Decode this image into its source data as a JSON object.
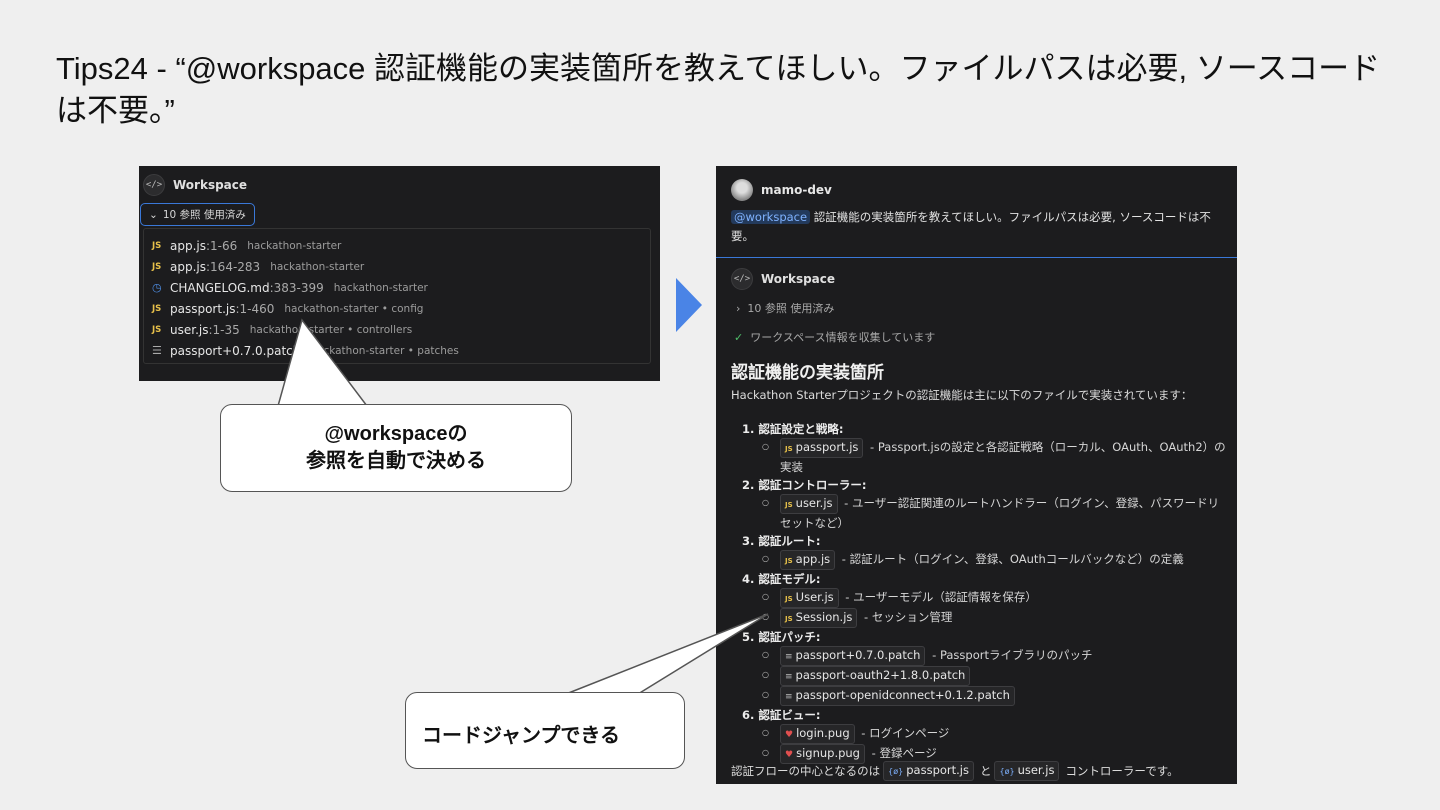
{
  "slide": {
    "title": "Tips24 - “@workspace 認証機能の実装箇所を教えてほしい。ファイルパスは必要, ソースコードは不要。”"
  },
  "left_panel": {
    "header_label": "Workspace",
    "header_icon": "code-icon",
    "references_toggle": "10 参照 使用済み",
    "references": [
      {
        "icon": "JS",
        "name": "app.js",
        "range": ":1-66",
        "location": "hackathon-starter"
      },
      {
        "icon": "JS",
        "name": "app.js",
        "range": ":164-283",
        "location": "hackathon-starter"
      },
      {
        "icon": "md",
        "name": "CHANGELOG.md",
        "range": ":383-399",
        "location": "hackathon-starter"
      },
      {
        "icon": "JS",
        "name": "passport.js",
        "range": ":1-460",
        "location": "hackathon-starter • config"
      },
      {
        "icon": "JS",
        "name": "user.js",
        "range": ":1-35",
        "location": "hackathon-starter • controllers"
      },
      {
        "icon": "patch",
        "name": "passport+0.7.0.patch",
        "range": "",
        "location": "hackathon-starter • patches"
      }
    ]
  },
  "right_panel": {
    "user_name": "mamo-dev",
    "prompt_mention": "@workspace",
    "prompt_text": " 認証機能の実装箇所を教えてほしい。ファイルパスは必要, ソースコードは不要。",
    "agent_label": "Workspace",
    "references_used": "10 参照 使用済み",
    "collecting_status": "ワークスペース情報を収集しています",
    "heading": "認証機能の実装箇所",
    "intro": "Hackathon Starterプロジェクトの認証機能は主に以下のファイルで実装されています：",
    "sections": [
      {
        "title": "1. 認証設定と戦略:",
        "items": [
          {
            "file": "passport.js",
            "icon": "js",
            "desc": " - Passport.jsの設定と各認証戦略（ローカル、OAuth、OAuth2）の実装"
          }
        ]
      },
      {
        "title": "2. 認証コントローラー:",
        "items": [
          {
            "file": "user.js",
            "icon": "js",
            "desc": " - ユーザー認証関連のルートハンドラー（ログイン、登録、パスワードリセットなど）"
          }
        ]
      },
      {
        "title": "3. 認証ルート:",
        "items": [
          {
            "file": "app.js",
            "icon": "js",
            "desc": " - 認証ルート（ログイン、登録、OAuthコールバックなど）の定義"
          }
        ]
      },
      {
        "title": "4. 認証モデル:",
        "items": [
          {
            "file": "User.js",
            "icon": "js",
            "desc": " - ユーザーモデル（認証情報を保存）"
          },
          {
            "file": "Session.js",
            "icon": "js",
            "desc": " - セッション管理"
          }
        ]
      },
      {
        "title": "5. 認証パッチ:",
        "items": [
          {
            "file": "passport+0.7.0.patch",
            "icon": "patch",
            "desc": " - Passportライブラリのパッチ"
          },
          {
            "file": "passport-oauth2+1.8.0.patch",
            "icon": "patch",
            "desc": ""
          },
          {
            "file": "passport-openidconnect+0.1.2.patch",
            "icon": "patch",
            "desc": ""
          }
        ]
      },
      {
        "title": "6. 認証ビュー:",
        "items": [
          {
            "file": "login.pug",
            "icon": "pug",
            "desc": " - ログインページ"
          },
          {
            "file": "signup.pug",
            "icon": "pug",
            "desc": " - 登録ページ"
          }
        ]
      }
    ],
    "footer_prefix": "認証フローの中心となるのは",
    "footer_file1": "passport.js",
    "footer_mid": "と",
    "footer_file2": "user.js",
    "footer_suffix": "コントローラーです。"
  },
  "callouts": {
    "auto_reference_line1": "@workspaceの",
    "auto_reference_line2": "参照を自動で決める",
    "code_jump": "コードジャンプできる"
  },
  "colors": {
    "slide_bg": "#efefef",
    "panel_bg": "#1c1c1e",
    "accent_blue": "#4a84e6",
    "js_yellow": "#e8c14a",
    "check_green": "#4fbf6a"
  }
}
